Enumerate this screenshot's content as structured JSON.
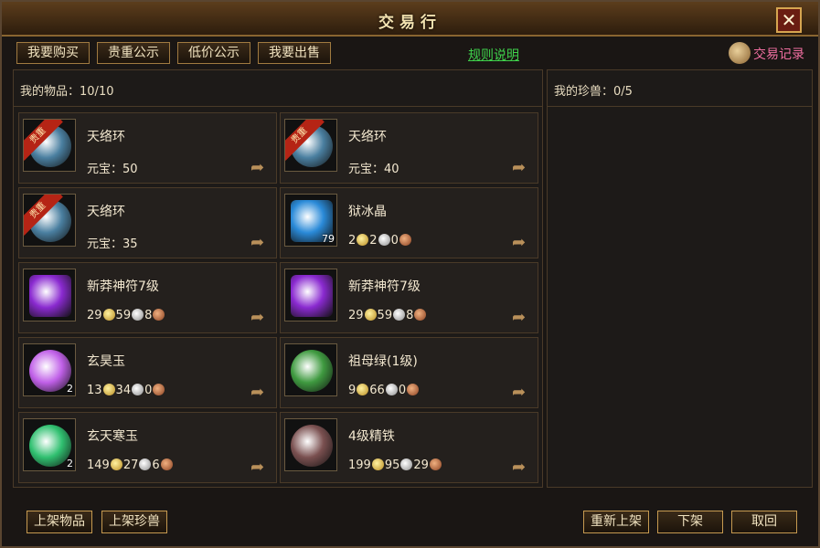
{
  "window": {
    "title": "交易行",
    "close_label": "✕"
  },
  "tabs": [
    {
      "label": "我要购买"
    },
    {
      "label": "贵重公示"
    },
    {
      "label": "低价公示"
    },
    {
      "label": "我要出售"
    }
  ],
  "rules_link": "规则说明",
  "trade_record": {
    "label": "交易记录",
    "icon": "scroll-icon"
  },
  "my_items": {
    "label": "我的物品：",
    "count": "10/10"
  },
  "my_pets": {
    "label": "我的珍兽：",
    "count": "0/5"
  },
  "currency_icons": {
    "gold": "#d8b040",
    "silver": "#c8c8c8",
    "copper": "#c07040"
  },
  "items": [
    {
      "name": "天络环",
      "price_label": "元宝：",
      "price": "50",
      "badge": "贵重",
      "icon": "ring-icon",
      "color": "#4a7fa0",
      "qty": ""
    },
    {
      "name": "天络环",
      "price_label": "元宝：",
      "price": "40",
      "badge": "贵重",
      "icon": "ring-icon",
      "color": "#4a7fa0",
      "qty": ""
    },
    {
      "name": "天络环",
      "price_label": "元宝：",
      "price": "35",
      "badge": "贵重",
      "icon": "ring-icon",
      "color": "#4a7fa0",
      "qty": ""
    },
    {
      "name": "狱冰晶",
      "gold": "2",
      "silver": "2",
      "copper": "0",
      "badge": "",
      "icon": "ice-crystal-icon",
      "color": "#2a8ad8",
      "qty": "79"
    },
    {
      "name": "新莽神符7级",
      "gold": "29",
      "silver": "59",
      "copper": "8",
      "badge": "",
      "icon": "talisman-icon",
      "color": "#8a2ad0",
      "qty": ""
    },
    {
      "name": "新莽神符7级",
      "gold": "29",
      "silver": "59",
      "copper": "8",
      "badge": "",
      "icon": "talisman-icon",
      "color": "#8a2ad0",
      "qty": ""
    },
    {
      "name": "玄昊玉",
      "gold": "13",
      "silver": "34",
      "copper": "0",
      "badge": "",
      "icon": "purple-orb-icon",
      "color": "#c060e8",
      "qty": "2"
    },
    {
      "name": "祖母绿(1级)",
      "gold": "9",
      "silver": "66",
      "copper": "0",
      "badge": "",
      "icon": "jade-ring-icon",
      "color": "#3f9a40",
      "qty": ""
    },
    {
      "name": "玄天寒玉",
      "gold": "149",
      "silver": "27",
      "copper": "6",
      "badge": "",
      "icon": "jade-disc-icon",
      "color": "#30c070",
      "qty": "2"
    },
    {
      "name": "4级精铁",
      "gold": "199",
      "silver": "95",
      "copper": "29",
      "badge": "",
      "icon": "iron-ore-icon",
      "color": "#7a5050",
      "qty": ""
    }
  ],
  "bottom_left_buttons": [
    {
      "label": "上架物品"
    },
    {
      "label": "上架珍兽"
    }
  ],
  "bottom_right_buttons": [
    {
      "label": "重新上架"
    },
    {
      "label": "下架"
    },
    {
      "label": "取回"
    }
  ]
}
